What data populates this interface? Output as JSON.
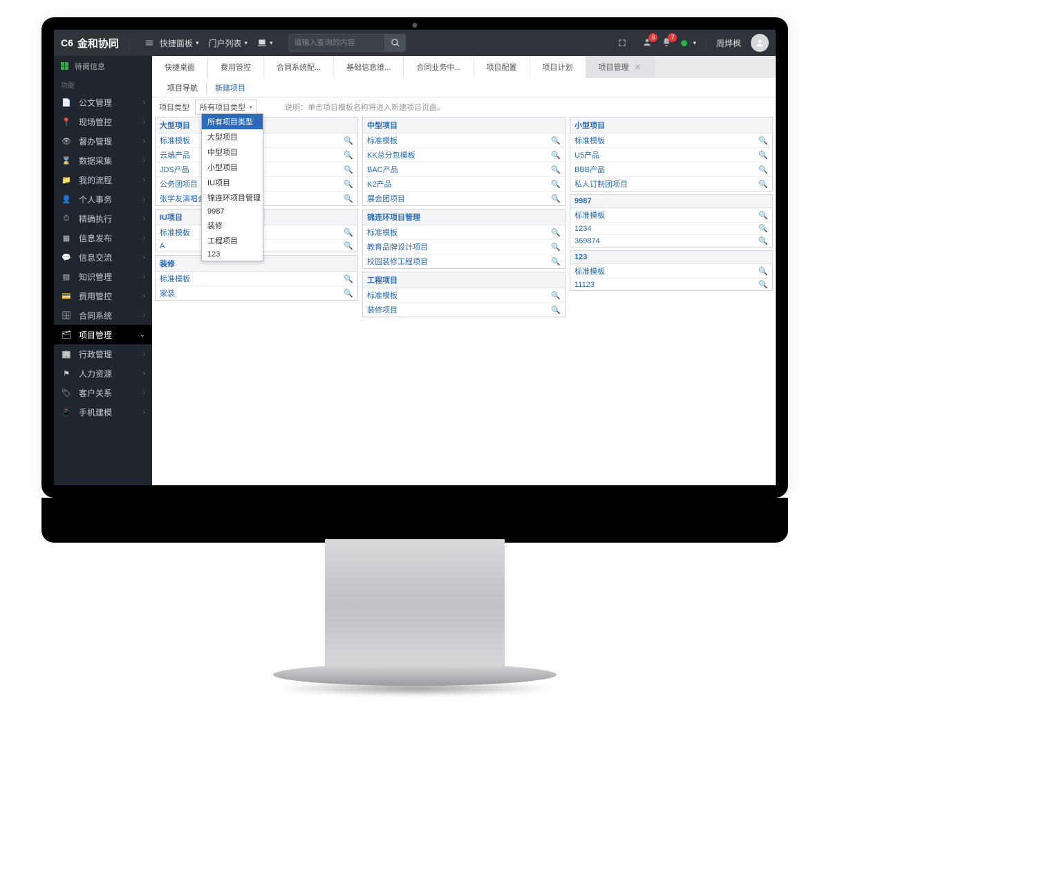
{
  "brand": {
    "code": "C6",
    "name": "金和协同"
  },
  "header": {
    "quick_panel": "快捷面板",
    "portal_list": "门户列表",
    "search_placeholder": "请输入查询的内容",
    "badge1": "6",
    "badge2": "7",
    "username": "周烨枫"
  },
  "leftnav": {
    "top_msg": "待阅信息",
    "section": "功能",
    "items": [
      {
        "ico": "📄",
        "label": "公文管理"
      },
      {
        "ico": "📍",
        "label": "现场管控"
      },
      {
        "ico": "👁",
        "label": "督办管理"
      },
      {
        "ico": "⌛",
        "label": "数据采集"
      },
      {
        "ico": "📁",
        "label": "我的流程"
      },
      {
        "ico": "👤",
        "label": "个人事务"
      },
      {
        "ico": "⏱",
        "label": "精确执行"
      },
      {
        "ico": "▦",
        "label": "信息发布"
      },
      {
        "ico": "💬",
        "label": "信息交流"
      },
      {
        "ico": "▤",
        "label": "知识管理"
      },
      {
        "ico": "💳",
        "label": "费用管控"
      },
      {
        "ico": "🗄",
        "label": "合同系统"
      },
      {
        "ico": "🗂",
        "label": "项目管理",
        "active": true,
        "open": true
      },
      {
        "ico": "🏢",
        "label": "行政管理"
      },
      {
        "ico": "⚑",
        "label": "人力资源"
      },
      {
        "ico": "🏷",
        "label": "客户关系"
      },
      {
        "ico": "📱",
        "label": "手机建模"
      }
    ]
  },
  "tabs": [
    {
      "label": "快捷桌面"
    },
    {
      "label": "费用管控"
    },
    {
      "label": "合同系统配..."
    },
    {
      "label": "基础信息维..."
    },
    {
      "label": "合同业务中..."
    },
    {
      "label": "项目配置"
    },
    {
      "label": "项目计划"
    },
    {
      "label": "项目管理",
      "current": true,
      "closable": true
    }
  ],
  "subtabs": {
    "nav": "项目导航",
    "new": "新建项目"
  },
  "filter": {
    "label": "项目类型",
    "selected": "所有项目类型",
    "hint": "说明：单击项目模板名称将进入新建项目页面。",
    "options": [
      "所有项目类型",
      "大型项目",
      "中型项目",
      "小型项目",
      "IU项目",
      "锦连环项目管理",
      "9987",
      "装修",
      "工程项目",
      "123"
    ]
  },
  "columns": [
    [
      {
        "title": "大型项目",
        "rows": [
          "标准模板",
          "云端产品",
          "JDS产品",
          "公务团项目",
          "张学友演唱会"
        ]
      },
      {
        "title": "IU项目",
        "rows": [
          "标准模板",
          "A"
        ]
      },
      {
        "title": "装修",
        "rows": [
          "标准模板",
          "家装"
        ]
      }
    ],
    [
      {
        "title": "中型项目",
        "rows": [
          "标准模板",
          "KK总分包模板",
          "BAC产品",
          "K2产品",
          "展会团项目"
        ]
      },
      {
        "title": "锦连环项目管理",
        "rows": [
          "标准模板",
          "教育品牌设计项目",
          "校园装修工程项目"
        ]
      },
      {
        "title": "工程项目",
        "rows": [
          "标准模板",
          "装修项目"
        ]
      }
    ],
    [
      {
        "title": "小型项目",
        "rows": [
          "标准模板",
          "U5产品",
          "BBB产品",
          "私人订制团项目"
        ]
      },
      {
        "title": "9987",
        "rows": [
          "标准模板",
          "1234",
          "369874"
        ]
      },
      {
        "title": "123",
        "rows": [
          "标准模板",
          "11123"
        ]
      }
    ]
  ]
}
